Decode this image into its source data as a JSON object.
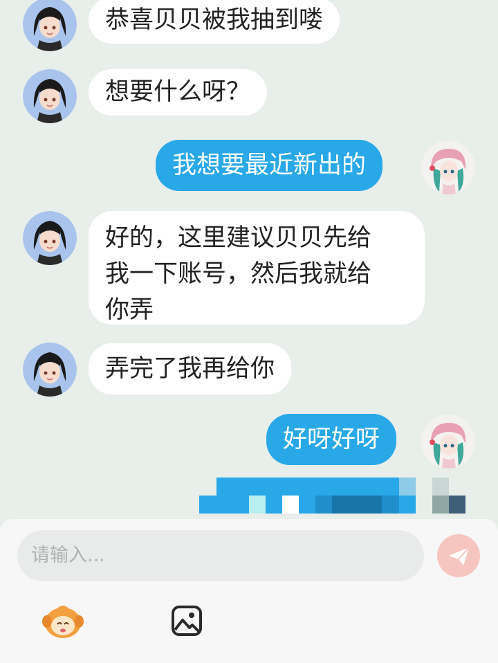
{
  "messages": [
    {
      "side": "in",
      "text": "恭喜贝贝被我抽到喽"
    },
    {
      "side": "in",
      "text": "想要什么呀？"
    },
    {
      "side": "out",
      "text": "我想要最近新出的"
    },
    {
      "side": "in",
      "lines": [
        "好的，这里建议贝贝先给",
        "我一下账号，然后我就给",
        "你弄"
      ]
    },
    {
      "side": "in",
      "text": "弄完了我再给你"
    },
    {
      "side": "out",
      "text": "好呀好呀"
    }
  ],
  "composer": {
    "placeholder": "请输入...",
    "send_icon": "send-icon",
    "emoji_icon": "mascot-emoji-icon",
    "image_icon": "image-icon"
  },
  "colors": {
    "outgoing_bubble": "#29a8e8",
    "incoming_bubble": "#ffffff",
    "background": "#e8eeea",
    "send_button": "#f6c5bf"
  }
}
